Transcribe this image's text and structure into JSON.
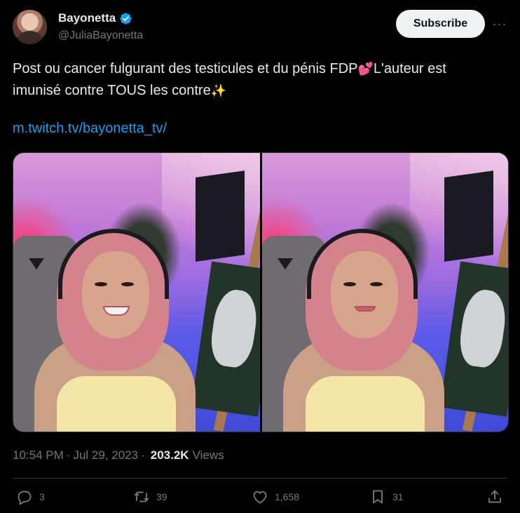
{
  "author": {
    "display_name": "Bayonetta",
    "handle": "@JuliaBayonetta",
    "verified_icon": "verified-badge-icon",
    "verified_color": "#1d9bf0"
  },
  "header": {
    "subscribe_label": "Subscribe",
    "more_label": "···"
  },
  "tweet": {
    "line1": "Post ou cancer fulgurant des testicules et du pénis FDP",
    "line1_emoji": "💕",
    "line1_tail": "L'auteur est",
    "line2": "imunisé contre TOUS les contre",
    "line2_emoji": "✨",
    "link_text": "m.twitch.tv/bayonetta_tv/",
    "link_color": "#1d9bf0"
  },
  "media": {
    "count": 2
  },
  "meta": {
    "time": "10:54 PM",
    "separator": "·",
    "date": "Jul 29, 2023",
    "views_count": "203.2K",
    "views_label": "Views"
  },
  "actions": {
    "replies": "3",
    "reposts": "39",
    "likes": "1,658",
    "bookmarks": "31"
  },
  "colors": {
    "background": "#000000",
    "text": "#e7e9ea",
    "muted": "#71767b",
    "divider": "#2f3336",
    "button_bg": "#eff3f4"
  }
}
